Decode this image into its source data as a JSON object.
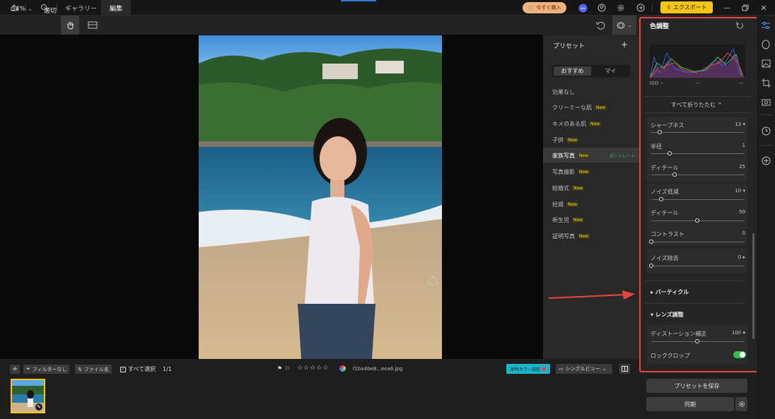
{
  "topbar": {
    "tabs": [
      {
        "label": "ギャラリー"
      },
      {
        "label": "編集"
      }
    ],
    "buy_label": "今すぐ購入",
    "export_label": "エクスポート"
  },
  "toolbar": {
    "zoom": "34%",
    "fit": "適切"
  },
  "presets": {
    "title": "プリセット",
    "add": "+",
    "tabs": [
      "おすすめ",
      "マイ"
    ],
    "items": [
      {
        "label": "効果なし",
        "new": false
      },
      {
        "label": "クリーミーな肌",
        "new": true
      },
      {
        "label": "キメのある肌",
        "new": true
      },
      {
        "label": "子供",
        "new": true
      },
      {
        "label": "家族写真",
        "new": true,
        "tag": "ポートレート"
      },
      {
        "label": "写真撮影",
        "new": true
      },
      {
        "label": "結婚式",
        "new": true
      },
      {
        "label": "妊婦",
        "new": true
      },
      {
        "label": "新生児",
        "new": true
      },
      {
        "label": "証明写真",
        "new": true
      }
    ],
    "new_label": "New"
  },
  "adjust": {
    "title": "色調整",
    "iso": "ISO --",
    "iso_mid": "--",
    "iso_right": "--",
    "collapse_all": "すべて折りたたむ ^",
    "group1": [
      {
        "label": "シャープネス",
        "value": "13 ▾",
        "pos": 0.13
      },
      {
        "label": "半径",
        "value": "1",
        "pos": 0.25
      },
      {
        "label": "ディテール",
        "value": "25",
        "pos": 0.3
      }
    ],
    "group2": [
      {
        "label": "ノイズ低減",
        "value": "10 ▾",
        "pos": 0.1
      },
      {
        "label": "ディテール",
        "value": "50",
        "pos": 0.5
      },
      {
        "label": "コントラスト",
        "value": "0",
        "pos": 0.0
      }
    ],
    "noise_removal": {
      "label": "ノイズ除去",
      "value": "0 ▸",
      "pos": 0.0
    },
    "particle": "▸ パーティクル",
    "lens": "▾ レンズ調整",
    "distortion": {
      "label": "ディストーション補正",
      "value": "100 ▾",
      "pos": 0.5
    },
    "lock_crop": {
      "label": "ロッククロップ",
      "on": true
    }
  },
  "bottom": {
    "add": "+",
    "filter": "フィルターなし",
    "sort": "ファイル名",
    "select_all": "すべて選択",
    "count": "1/1",
    "stars": "☆☆☆☆☆",
    "filename": "f1ba4be8...eea6.jpg",
    "realtime": "即時カラー調整",
    "view": "シングルビュー",
    "save_preset": "プリセットを保存",
    "sync": "同期"
  },
  "colors": {
    "accent_yellow": "#f5c518",
    "highlight_red": "#e8453c",
    "toggle_green": "#2fbf4a",
    "realtime_cyan": "#1fb5c9"
  }
}
